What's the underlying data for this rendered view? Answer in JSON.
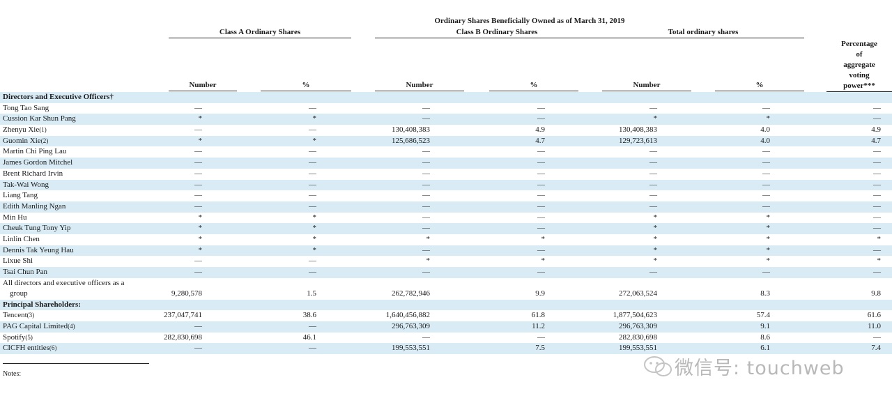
{
  "header": {
    "title": "Ordinary Shares Beneficially Owned as of March 31, 2019",
    "groups": [
      "Class A Ordinary Shares",
      "Class B Ordinary Shares",
      "Total ordinary shares"
    ],
    "pct_lines": [
      "Percentage",
      "of",
      "aggregate",
      "voting",
      "power***"
    ],
    "columns": [
      "Number",
      "%",
      "Number",
      "%",
      "Number",
      "%"
    ]
  },
  "rows": [
    {
      "label": "Directors and Executive Officers†",
      "section": true,
      "cells": [
        "",
        "",
        "",
        "",
        "",
        "",
        ""
      ]
    },
    {
      "label": "Tong Tao Sang",
      "cells": [
        "—",
        "—",
        "—",
        "—",
        "—",
        "—",
        "—"
      ]
    },
    {
      "label": "Cussion Kar Shun Pang",
      "cells": [
        "*",
        "*",
        "—",
        "—",
        "*",
        "*",
        "—"
      ]
    },
    {
      "label": "Zhenyu Xie",
      "fn": "(1)",
      "cells": [
        "—",
        "—",
        "130,408,383",
        "4.9",
        "130,408,383",
        "4.0",
        "4.9"
      ]
    },
    {
      "label": "Guomin Xie",
      "fn": "(2)",
      "cells": [
        "*",
        "*",
        "125,686,523",
        "4.7",
        "129,723,613",
        "4.0",
        "4.7"
      ]
    },
    {
      "label": "Martin Chi Ping Lau",
      "cells": [
        "—",
        "—",
        "—",
        "—",
        "—",
        "—",
        "—"
      ]
    },
    {
      "label": "James Gordon Mitchel",
      "cells": [
        "—",
        "—",
        "—",
        "—",
        "—",
        "—",
        "—"
      ]
    },
    {
      "label": "Brent Richard Irvin",
      "cells": [
        "—",
        "—",
        "—",
        "—",
        "—",
        "—",
        "—"
      ]
    },
    {
      "label": "Tak-Wai Wong",
      "cells": [
        "—",
        "—",
        "—",
        "—",
        "—",
        "—",
        "—"
      ]
    },
    {
      "label": "Liang Tang",
      "cells": [
        "—",
        "—",
        "—",
        "—",
        "—",
        "—",
        "—"
      ]
    },
    {
      "label": "Edith Manling Ngan",
      "cells": [
        "—",
        "—",
        "—",
        "—",
        "—",
        "—",
        "—"
      ]
    },
    {
      "label": "Min Hu",
      "cells": [
        "*",
        "*",
        "—",
        "—",
        "*",
        "*",
        "—"
      ]
    },
    {
      "label": "Cheuk Tung Tony Yip",
      "cells": [
        "*",
        "*",
        "—",
        "—",
        "*",
        "*",
        "—"
      ]
    },
    {
      "label": "Linlin Chen",
      "cells": [
        "*",
        "*",
        "*",
        "*",
        "*",
        "*",
        "*"
      ]
    },
    {
      "label": "Dennis Tak Yeung Hau",
      "cells": [
        "*",
        "*",
        "—",
        "—",
        "*",
        "*",
        "—"
      ]
    },
    {
      "label": "Lixue Shi",
      "cells": [
        "—",
        "—",
        "*",
        "*",
        "*",
        "*",
        "*"
      ]
    },
    {
      "label": "Tsai Chun Pan",
      "cells": [
        "—",
        "—",
        "—",
        "—",
        "—",
        "—",
        "—"
      ]
    },
    {
      "label": "All directors and executive officers as a",
      "label2": "group",
      "tall": true,
      "cells": [
        "9,280,578",
        "1.5",
        "262,782,946",
        "9.9",
        "272,063,524",
        "8.3",
        "9.8"
      ]
    },
    {
      "label": "Principal Shareholders:",
      "section": true,
      "cells": [
        "",
        "",
        "",
        "",
        "",
        "",
        ""
      ]
    },
    {
      "label": "Tencent",
      "fn": "(3)",
      "cells": [
        "237,047,741",
        "38.6",
        "1,640,456,882",
        "61.8",
        "1,877,504,623",
        "57.4",
        "61.6"
      ]
    },
    {
      "label": "PAG Capital Limited",
      "fn": "(4)",
      "cells": [
        "—",
        "—",
        "296,763,309",
        "11.2",
        "296,763,309",
        "9.1",
        "11.0"
      ]
    },
    {
      "label": "Spotify",
      "fn": "(5)",
      "cells": [
        "282,830,698",
        "46.1",
        "—",
        "—",
        "282,830,698",
        "8.6",
        "—"
      ]
    },
    {
      "label": "CICFH entities",
      "fn": "(6)",
      "cells": [
        "—",
        "—",
        "199,553,551",
        "7.5",
        "199,553,551",
        "6.1",
        "7.4"
      ]
    }
  ],
  "notes_label": "Notes:",
  "watermark": "微信号: touchweb"
}
